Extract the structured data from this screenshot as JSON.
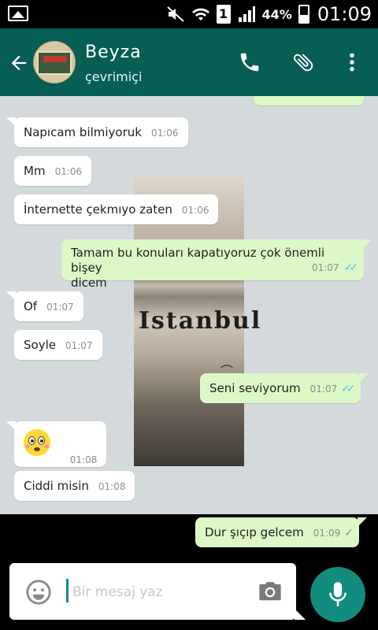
{
  "status_bar": {
    "battery_percent": "44%",
    "time": "01:09",
    "sim_label": "1"
  },
  "header": {
    "contact_name": "Beyza",
    "contact_status": "çevrimiçi",
    "wallpaper_text": "Istanbul"
  },
  "messages": [
    {
      "id": "m1",
      "direction": "in",
      "text": "Napıcam bilmiyoruk",
      "time": "01:06"
    },
    {
      "id": "m2",
      "direction": "in",
      "text": "Mm",
      "time": "01:06"
    },
    {
      "id": "m3",
      "direction": "in",
      "text": "İnternette çekmıyo zaten",
      "time": "01:06"
    },
    {
      "id": "m4",
      "direction": "out",
      "text_line1": "Tamam bu konuları kapatıyoruz çok önemli bişey",
      "text_line2": "dicem",
      "time": "01:07",
      "status": "read"
    },
    {
      "id": "m5",
      "direction": "in",
      "text": "Of",
      "time": "01:07"
    },
    {
      "id": "m6",
      "direction": "in",
      "text": "Soyle",
      "time": "01:07"
    },
    {
      "id": "m7",
      "direction": "out",
      "text": "Seni seviyorum",
      "time": "01:07",
      "status": "read"
    },
    {
      "id": "m8",
      "direction": "in",
      "emoji": "flushed-face",
      "time": "01:08"
    },
    {
      "id": "m9",
      "direction": "in",
      "text": "Ciddi misin",
      "time": "01:08"
    },
    {
      "id": "m10",
      "direction": "out",
      "text": "Dur şıçıp gelcem",
      "time": "01:09",
      "status": "sent"
    }
  ],
  "composer": {
    "placeholder": "Bir mesaj yaz",
    "value": ""
  },
  "colors": {
    "header": "#075e54",
    "accent": "#128c7e",
    "outgoing_bubble": "#dcf8c6",
    "incoming_bubble": "#ffffff",
    "read_ticks": "#4fc3f7"
  },
  "icons": {
    "back": "arrow-left-icon",
    "call": "phone-icon",
    "attach": "paperclip-icon",
    "menu": "more-vertical-icon",
    "emoji": "smiley-icon",
    "camera": "camera-icon",
    "mic": "microphone-icon"
  }
}
